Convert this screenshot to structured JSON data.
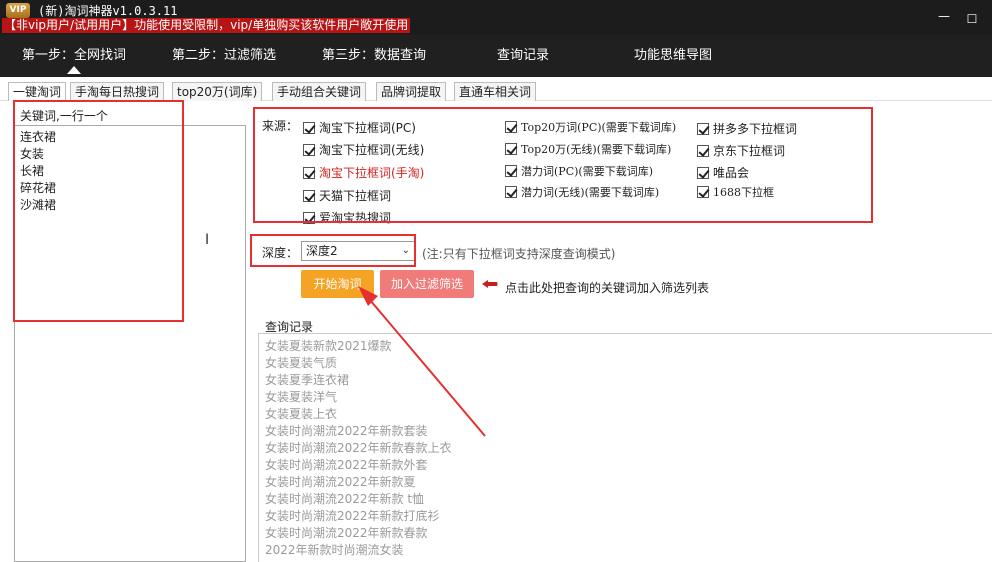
{
  "titlebar": {
    "logo": "VIP",
    "title": "(新)淘词神器v1.0.3.11",
    "warning": "【非vip用户/试用用户】功能使用受限制，vip/单独购买该软件用户敞开使用",
    "minimize_label": "—",
    "maximize_label": "☐"
  },
  "nav": {
    "items": [
      "第一步：全网找词",
      "第二步：过滤筛选",
      "第三步：数据查询",
      "查询记录",
      "功能思维导图"
    ]
  },
  "tabs": [
    "一键淘词",
    "手淘每日热搜词",
    "top20万(词库)",
    "手动组合关键词",
    "品牌词提取",
    "直通车相关词"
  ],
  "keywords": {
    "label": "关键词,一行一个",
    "lines": [
      "连衣裙",
      "女装",
      "长裙",
      "碎花裙",
      "沙滩裙"
    ]
  },
  "source": {
    "label": "来源：",
    "col1": [
      "淘宝下拉框词(PC)",
      "淘宝下拉框词(无线)",
      "淘宝下拉框词(手淘)",
      "天猫下拉框词",
      "爱淘宝热搜词"
    ],
    "col2": [
      "Top20万词(PC)(需要下载词库)",
      "Top20万(无线)(需要下载词库)",
      "潜力词(PC)(需要下载词库)",
      "潜力词(无线)(需要下载词库)"
    ],
    "col3": [
      "拼多多下拉框词",
      "京东下拉框词",
      "唯品会",
      "1688下拉框"
    ]
  },
  "depth": {
    "label": "深度：",
    "value": "深度2",
    "note": "(注:只有下拉框词支持深度查询模式)"
  },
  "actions": {
    "start": "开始淘词",
    "add_filter": "加入过滤筛选",
    "hint": "点击此处把查询的关键词加入筛选列表"
  },
  "history": {
    "label": "查询记录",
    "lines": [
      "女装夏装新款2021爆款",
      "女装夏装气质",
      "女装夏季连衣裙",
      "女装夏装洋气",
      "女装夏装上衣",
      "女装时尚潮流2022年新款套装",
      "女装时尚潮流2022年新款春款上衣",
      "女装时尚潮流2022年新款外套",
      "女装时尚潮流2022年新款夏",
      "女装时尚潮流2022年新款 t恤",
      "女装时尚潮流2022年新款打底衫",
      "女装时尚潮流2022年新款春款",
      "2022年新款时尚潮流女装"
    ]
  },
  "colors": {
    "highlight": "#e53030",
    "start_button": "#f5a325",
    "add_button": "#f07b78",
    "warning_bg": "#b71515"
  }
}
